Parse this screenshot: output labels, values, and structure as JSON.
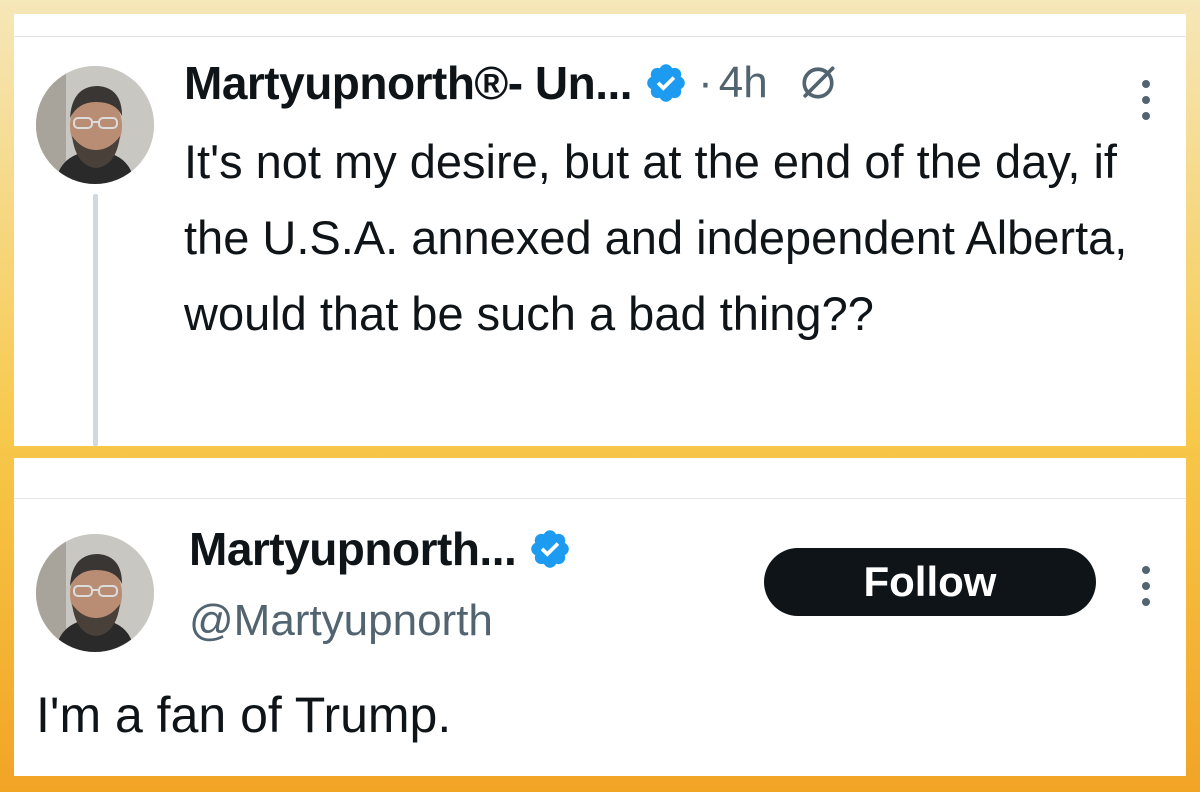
{
  "reply_tweet": {
    "display_name": "Martyupnorth®- Un...",
    "separator": "·",
    "time": "4h",
    "text": "It's not my desire, but at the end of the day, if the U.S.A. annexed and independent Alberta, would that be such a bad thing??",
    "icons": [
      "avatar",
      "verified-badge-icon",
      "grok-icon",
      "more-options-icon"
    ]
  },
  "profile_card": {
    "display_name": "Martyupnorth...",
    "handle": "@Martyupnorth",
    "follow_label": "Follow",
    "bio": "I'm a fan of Trump.",
    "icons": [
      "avatar",
      "verified-badge-icon",
      "more-options-icon"
    ]
  },
  "colors": {
    "verified_blue": "#1d9bf0",
    "text_primary": "#0f1419",
    "text_secondary": "#536471",
    "follow_button_bg": "#0f1419",
    "frame_top": "#f6e7b9",
    "frame_bottom": "#f2a425"
  }
}
